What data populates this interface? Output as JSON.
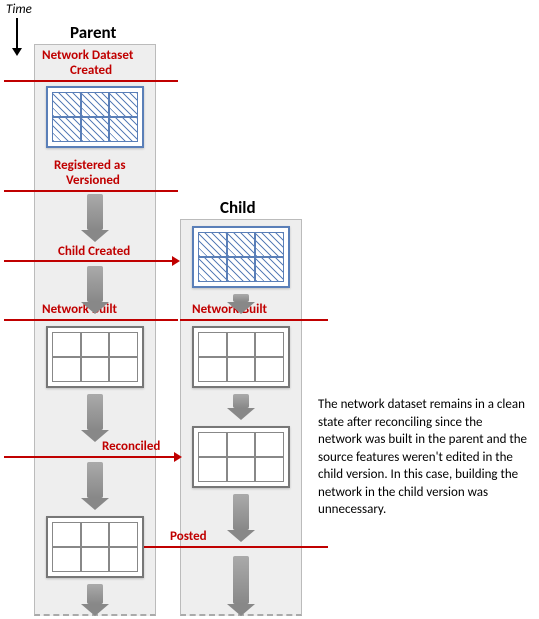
{
  "time_label": "Time",
  "parent": {
    "title": "Parent"
  },
  "child": {
    "title": "Child"
  },
  "labels": {
    "network_dataset_created_1": "Network Dataset",
    "network_dataset_created_2": "Created",
    "registered_as": "Registered as",
    "versioned": "Versioned",
    "child_created": "Child Created",
    "network_built_parent": "Network Built",
    "network_built_child": "Network Built",
    "reconciled": "Reconciled",
    "posted": "Posted"
  },
  "side_text": "The network dataset remains in a clean state after reconciling since the network was built in the parent and the source features weren't edited in the child version. In this case, building the network in the child version was unnecessary."
}
